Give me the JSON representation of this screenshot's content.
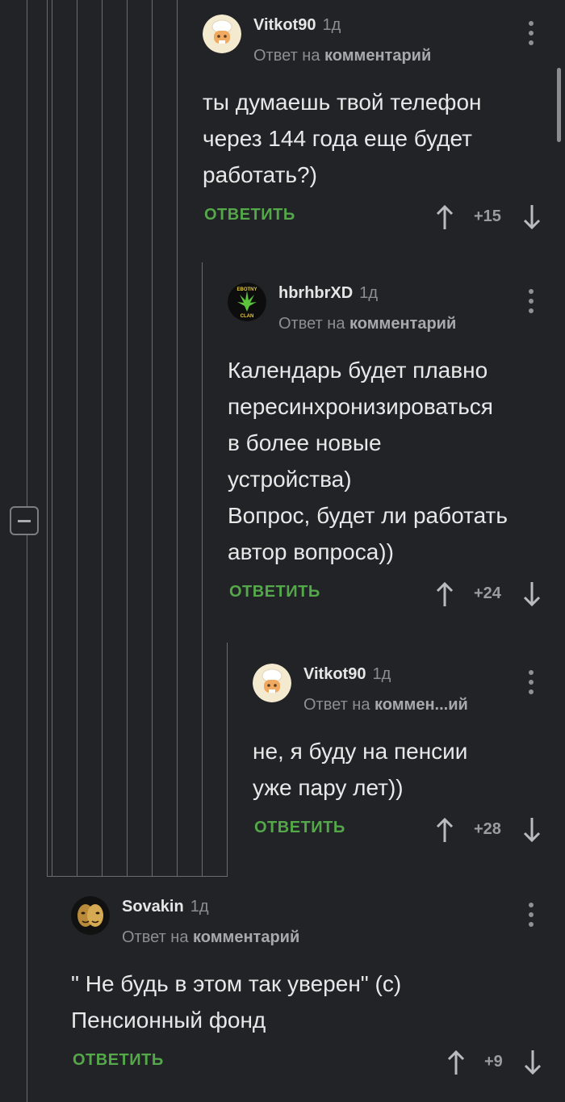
{
  "colors": {
    "background": "#212326",
    "reply_action": "#55a84a",
    "muted_text": "#8c8e91",
    "thread_line": "#6a6c70"
  },
  "comments": [
    {
      "username": "Vitkot90",
      "time": "1д",
      "reply_prefix": "Ответ на",
      "reply_target": "комментарий",
      "text": "ты думаешь твой телефон\nчерез 144 года еще будет\nработать?)",
      "reply_label": "ОТВЕТИТЬ",
      "score": "+15",
      "avatar_icon": "chef-cat-avatar-icon"
    },
    {
      "username": "hbrhbrXD",
      "time": "1д",
      "reply_prefix": "Ответ на",
      "reply_target": "комментарий",
      "text": "Календарь будет плавно\nпересинхронизироваться\nв более новые\nустройства)\nВопрос, будет ли работать\nавтор вопроса))",
      "reply_label": "ОТВЕТИТЬ",
      "score": "+24",
      "avatar_icon": "leaf-clan-avatar-icon",
      "avatar_text_top": "EBOTNY",
      "avatar_text_bottom": "CLAN"
    },
    {
      "username": "Vitkot90",
      "time": "1д",
      "reply_prefix": "Ответ на",
      "reply_target": "коммен...ий",
      "text": "не, я буду на пенсии\nуже пару лет))",
      "reply_label": "ОТВЕТИТЬ",
      "score": "+28",
      "avatar_icon": "chef-cat-avatar-icon"
    },
    {
      "username": "Sovakin",
      "time": "1д",
      "reply_prefix": "Ответ на",
      "reply_target": "комментарий",
      "text": "\" Не будь в этом так уверен\" (с)\nПенсионный фонд",
      "reply_label": "ОТВЕТИТЬ",
      "score": "+9",
      "avatar_icon": "golden-mask-avatar-icon"
    }
  ]
}
